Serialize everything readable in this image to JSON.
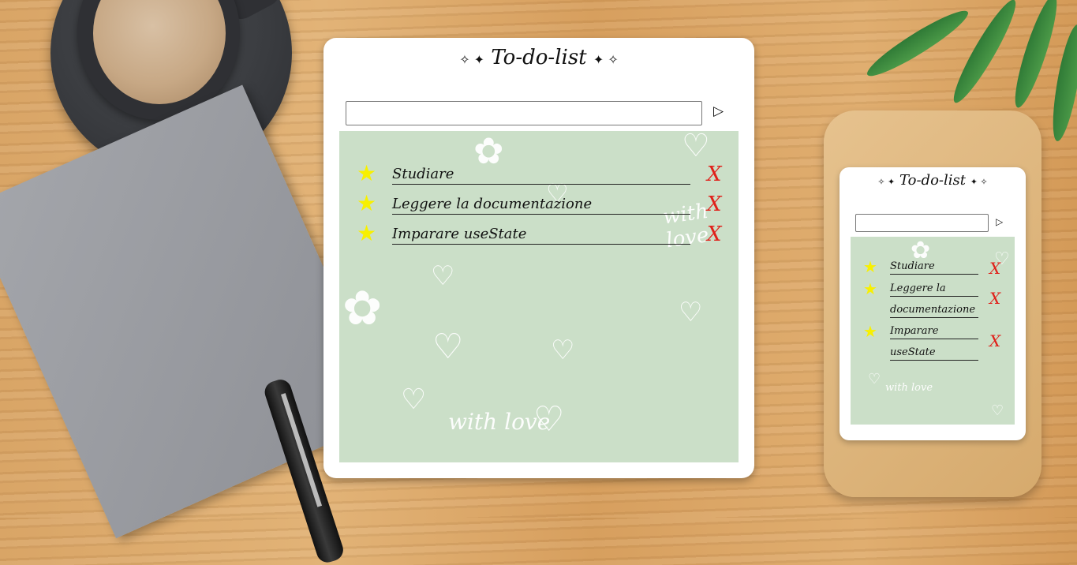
{
  "app": {
    "title": "To-do-list",
    "title_left_sparkles": "✧ ✦",
    "title_right_sparkles": "✦ ✧",
    "input_value": "",
    "input_placeholder": "",
    "send_icon": "▷",
    "delete_symbol": "X",
    "todos": [
      {
        "text": "Studiare",
        "starred": true
      },
      {
        "text": "Leggere la documentazione",
        "starred": true
      },
      {
        "text": "Imparare useState",
        "starred": true
      }
    ],
    "small_todos_wrapped": [
      [
        "Studiare"
      ],
      [
        "Leggere la",
        "documentazione"
      ],
      [
        "Imparare",
        "useState"
      ]
    ],
    "background_text": "with love"
  },
  "colors": {
    "list_background": "#cbdfc8",
    "star": "#f8f000",
    "delete": "#e0201a"
  },
  "icons": {
    "star": "★",
    "heart": "♡",
    "flower": "✿"
  }
}
